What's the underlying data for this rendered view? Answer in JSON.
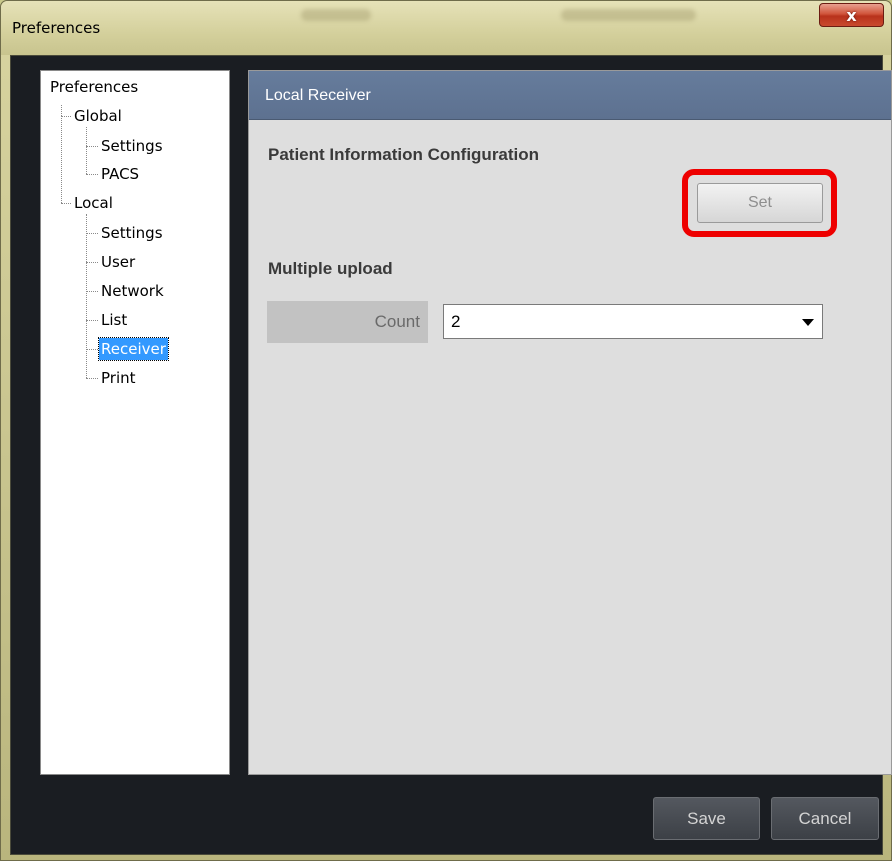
{
  "window": {
    "title": "Preferences",
    "close_glyph": "x"
  },
  "tree": {
    "root": "Preferences",
    "global": "Global",
    "global_settings": "Settings",
    "global_pacs": "PACS",
    "local": "Local",
    "local_settings": "Settings",
    "local_user": "User",
    "local_network": "Network",
    "local_list": "List",
    "local_receiver": "Receiver",
    "local_print": "Print",
    "selected": "Receiver"
  },
  "panel": {
    "header": "Local Receiver",
    "patient_section_title": "Patient Information Configuration",
    "set_button": "Set",
    "multiple_upload_title": "Multiple upload",
    "count_label": "Count",
    "count_value": "2"
  },
  "footer": {
    "save": "Save",
    "cancel": "Cancel"
  },
  "colors": {
    "header_bg": "#5f7393",
    "highlight_border": "#ee0000",
    "selected_bg": "#3399ff",
    "client_bg": "#1a1d22"
  }
}
